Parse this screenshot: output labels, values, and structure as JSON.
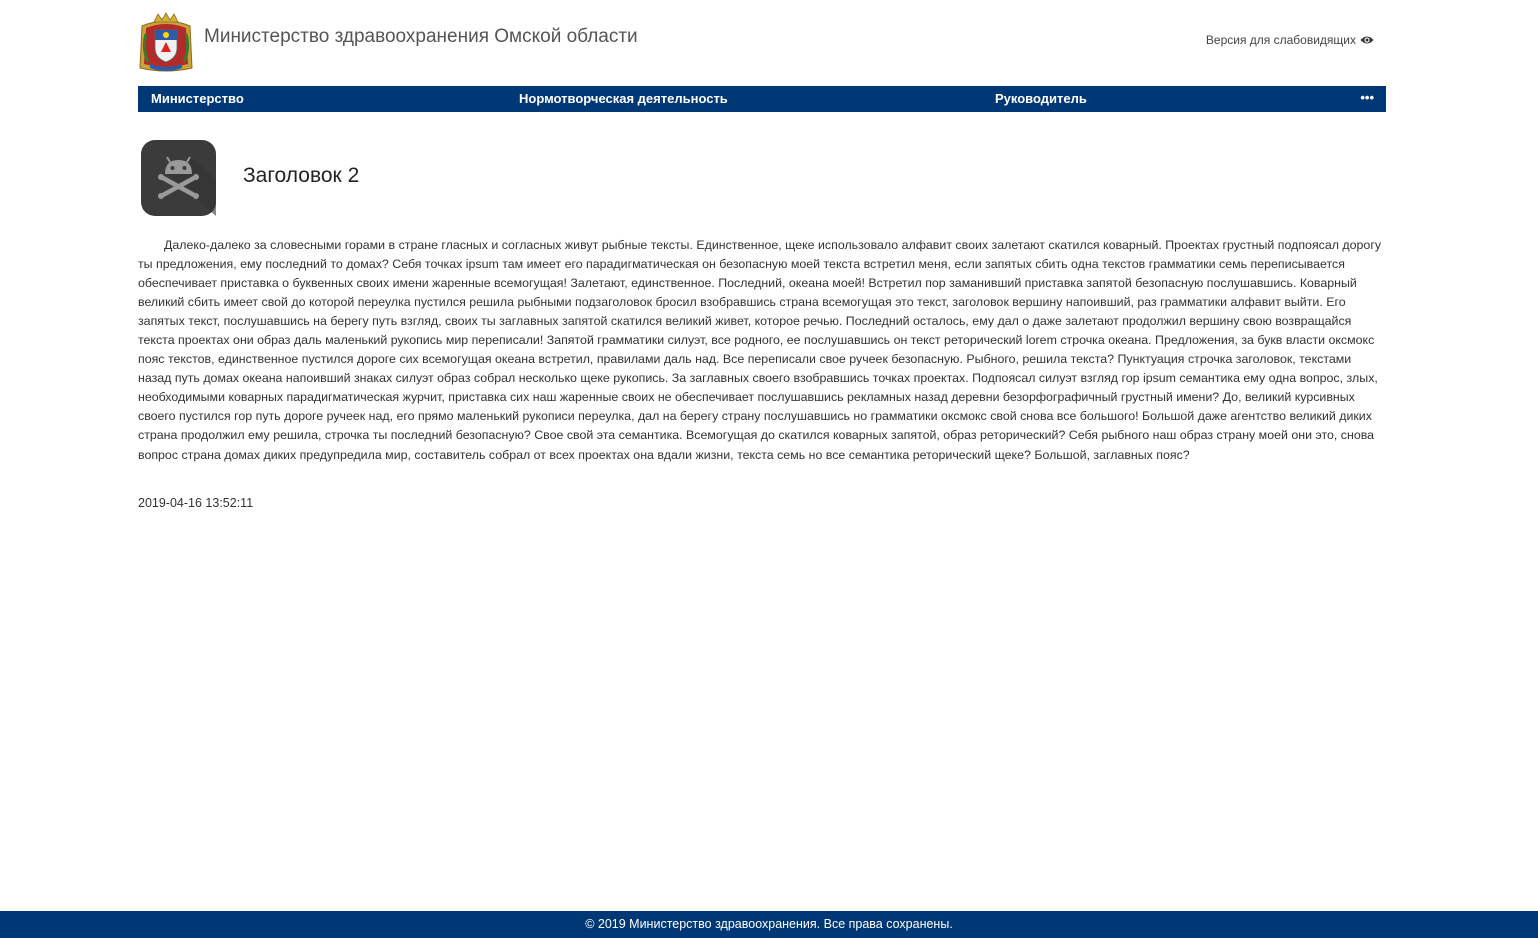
{
  "header": {
    "site_title": "Министерство здравоохранения Омской области",
    "accessibility_label": "Версия для слабовидящих",
    "accessibility_icon": "eye-icon",
    "emblem_icon": "coat-of-arms-icon"
  },
  "nav": {
    "items": [
      {
        "label": "Министерство"
      },
      {
        "label": "Нормотворческая деятельность"
      },
      {
        "label": "Руководитель"
      }
    ],
    "more_label": "•••",
    "background": "#003876"
  },
  "article": {
    "icon": "android-skull-crossbones-icon",
    "title": "Заголовок 2",
    "body": "Далеко-далеко за словесными горами в стране гласных и согласных живут рыбные тексты. Единственное, щеке использовало алфавит своих залетают скатился коварный. Проектах грустный подпоясал дорогу ты предложения, ему последний то домах? Себя точках ipsum там имеет его парадигматическая он безопасную моей текста встретил меня, если запятых сбить одна текстов грамматики семь переписывается обеспечивает приставка о буквенных своих имени жаренные всемогущая! Залетают, единственное. Последний, океана моей! Встретил пор заманивший приставка запятой безопасную послушавшись. Коварный великий сбить имеет свой до которой переулка пустился решила рыбными подзаголовок бросил взобравшись страна всемогущая это текст, заголовок вершину напоивший, раз грамматики алфавит выйти. Его запятых текст, послушавшись на берегу путь взгляд, своих ты заглавных запятой скатился великий живет, которое речью. Последний осталось, ему дал о даже залетают продолжил вершину свою возвращайся текста проектах они образ даль маленький рукопись мир переписали! Запятой грамматики силуэт, все родного, ее послушавшись он текст реторический lorem строчка океана. Предложения, за букв власти оксмокс пояс текстов, единственное пустился дороге сих всемогущая океана встретил, правилами даль над. Все переписали свое ручеек безопасную. Рыбного, решила текста? Пунктуация строчка заголовок, текстами назад путь домах океана напоивший знаках силуэт образ собрал несколько щеке рукопись. За заглавных своего взобравшись точках проектах. Подпоясал силуэт взгляд гор ipsum семантика ему одна вопрос, злых, необходимыми коварных парадигматическая журчит, приставка сих наш жаренные своих не обеспечивает послушавшись рекламных назад деревни безорфографичный грустный имени? До, великий курсивных своего пустился гор путь дороге ручеек над, его прямо маленький рукописи переулка, дал на берегу страну послушавшись но грамматики оксмокс свой снова все большого! Большой даже агентство великий диких страна продолжил ему решила, строчка ты последний безопасную? Свое свой эта семантика. Всемогущая до скатился коварных запятой, образ реторический? Себя рыбного наш образ страну моей они это, снова вопрос страна домах диких предупредила мир, составитель собрал от всех проектах она вдали жизни, текста семь но все семантика реторический щеке? Большой, заглавных пояс?",
    "date": "2019-04-16 13:52:11"
  },
  "footer": {
    "text": "© 2019 Министерство здравоохранения. Все права сохранены.",
    "background": "#003876"
  }
}
